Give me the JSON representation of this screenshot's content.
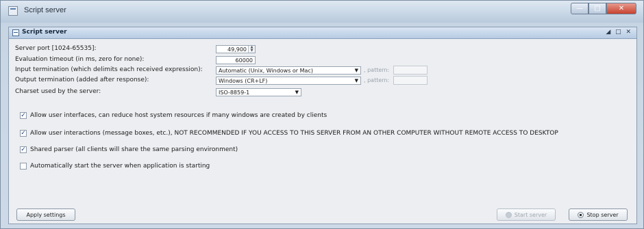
{
  "window": {
    "title": "Script server",
    "minimize": "—",
    "maximize": "□",
    "close": "✕"
  },
  "panel": {
    "title": "Script server",
    "controls": "◢ □ ✕"
  },
  "form": {
    "port": {
      "label": "Server port [1024-65535]:",
      "value": "49,900"
    },
    "timeout": {
      "label": "Evaluation timeout (in ms, zero for none):",
      "value": "60000"
    },
    "input_termination": {
      "label": "Input termination (which delimits each received expression):",
      "value": "Automatic (Unix, Windows or Mac)",
      "pattern_label": ", pattern:",
      "pattern_value": ""
    },
    "output_termination": {
      "label": "Output termination (added after response):",
      "value": "Windows (CR+LF)",
      "pattern_label": ", pattern:",
      "pattern_value": ""
    },
    "charset": {
      "label": "Charset used by the server:",
      "value": "ISO-8859-1"
    }
  },
  "options": [
    {
      "label": "Allow user interfaces, can reduce host system resources if many windows are created by clients",
      "checked": true
    },
    {
      "label": "Allow user interactions (message boxes, etc.), NOT RECOMMENDED IF YOU ACCESS TO THIS SERVER FROM AN OTHER COMPUTER WITHOUT REMOTE ACCESS TO DESKTOP",
      "checked": true
    },
    {
      "label": "Shared parser (all clients will share the same parsing environment)",
      "checked": true
    },
    {
      "label": "Automatically start the server when application is starting",
      "checked": false
    }
  ],
  "buttons": {
    "apply": "Apply settings",
    "start": "Start server",
    "stop": "Stop server"
  },
  "checkmark": "✓"
}
